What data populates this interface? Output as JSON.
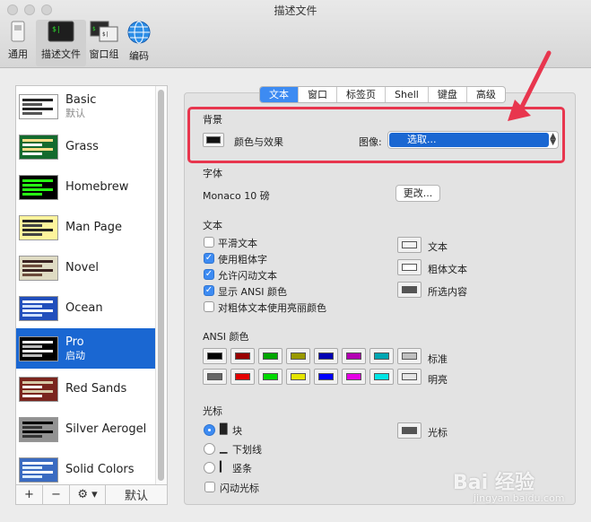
{
  "window": {
    "title": "描述文件"
  },
  "toolbar": [
    {
      "label": "通用",
      "icon": "switch-icon"
    },
    {
      "label": "描述文件",
      "icon": "terminal-icon"
    },
    {
      "label": "窗口组",
      "icon": "window-group-icon"
    },
    {
      "label": "编码",
      "icon": "globe-icon"
    }
  ],
  "profiles": [
    {
      "name": "Basic",
      "sub": "默认",
      "bg": "#ffffff",
      "bars": [
        "#222222",
        "#555555"
      ]
    },
    {
      "name": "Grass",
      "sub": "",
      "bg": "#146b2e",
      "bars": [
        "#ffdd88",
        "#ffffff"
      ]
    },
    {
      "name": "Homebrew",
      "sub": "",
      "bg": "#000000",
      "bars": [
        "#28fe14",
        "#28fe14"
      ]
    },
    {
      "name": "Man Page",
      "sub": "",
      "bg": "#fef49c",
      "bars": [
        "#222222",
        "#444444"
      ]
    },
    {
      "name": "Novel",
      "sub": "",
      "bg": "#dfdbc3",
      "bars": [
        "#3b2322",
        "#6b4a3a"
      ]
    },
    {
      "name": "Ocean",
      "sub": "",
      "bg": "#224fbc",
      "bars": [
        "#ffffff",
        "#cfe0ff"
      ]
    },
    {
      "name": "Pro",
      "sub": "启动",
      "bg": "#000000",
      "bars": [
        "#f2f2f2",
        "#bbbbbb"
      ]
    },
    {
      "name": "Red Sands",
      "sub": "",
      "bg": "#7a251e",
      "bars": [
        "#d7c9a7",
        "#ffffff"
      ]
    },
    {
      "name": "Silver Aerogel",
      "sub": "",
      "bg": "#929292",
      "bars": [
        "#000000",
        "#333333"
      ]
    },
    {
      "name": "Solid Colors",
      "sub": "",
      "bg": "#3a6bc1",
      "bars": [
        "#ffffff",
        "#ddeeff"
      ]
    }
  ],
  "sidebar_bottom": {
    "add": "+",
    "remove": "−",
    "gear": "⚙︎ ▾",
    "default": "默认"
  },
  "tabs": [
    "文本",
    "窗口",
    "标签页",
    "Shell",
    "键盘",
    "高级"
  ],
  "background": {
    "title": "背景",
    "color_effect_label": "颜色与效果",
    "image_label": "图像:",
    "image_value": "选取...",
    "color": "#111111"
  },
  "font": {
    "title": "字体",
    "value": "Monaco 10 磅",
    "change_button": "更改..."
  },
  "text": {
    "title": "文本",
    "options": [
      {
        "label": "平滑文本",
        "checked": false
      },
      {
        "label": "使用粗体字",
        "checked": true
      },
      {
        "label": "允许闪动文本",
        "checked": true
      },
      {
        "label": "显示 ANSI 颜色",
        "checked": true
      },
      {
        "label": "对粗体文本使用亮丽颜色",
        "checked": false
      }
    ],
    "color_wells": [
      {
        "label": "文本",
        "color": "#f4f4f4"
      },
      {
        "label": "粗体文本",
        "color": "#ffffff"
      },
      {
        "label": "所选内容",
        "color": "#555555"
      }
    ]
  },
  "ansi": {
    "title": "ANSI 颜色",
    "normal_label": "标准",
    "bright_label": "明亮",
    "normal": [
      "#000000",
      "#990000",
      "#00a600",
      "#999900",
      "#0000b2",
      "#b200b2",
      "#00a6b2",
      "#bfbfbf"
    ],
    "bright": [
      "#666666",
      "#e50000",
      "#00d900",
      "#e5e500",
      "#0000ff",
      "#e500e5",
      "#00e5e5",
      "#e5e5e5"
    ]
  },
  "cursor": {
    "title": "光标",
    "options": [
      {
        "label": "块",
        "checked": true,
        "glyph": "█"
      },
      {
        "label": "下划线",
        "checked": false,
        "glyph": "▁"
      },
      {
        "label": "竖条",
        "checked": false,
        "glyph": "▎"
      }
    ],
    "blink_label": "闪动光标",
    "blink_checked": false,
    "color_label": "光标",
    "color": "#555555"
  },
  "watermark": {
    "main": "Bai 经验",
    "sub": "jingyan.baidu.com"
  }
}
